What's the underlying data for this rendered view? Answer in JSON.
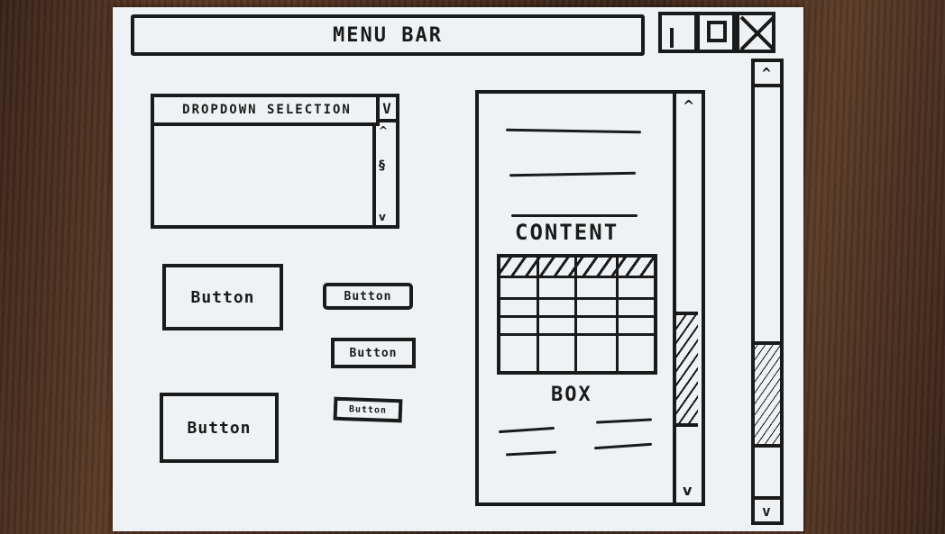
{
  "menu_bar": {
    "label": "MENU BAR"
  },
  "window_controls": {
    "minimize_icon": "minimize-icon",
    "maximize_icon": "maximize-icon",
    "close_icon": "close-icon"
  },
  "dropdown": {
    "label": "DROPDOWN SELECTION",
    "toggle": "V",
    "scroll_up": "^",
    "scroll_down": "v"
  },
  "buttons": {
    "large_1": "Button",
    "large_2": "Button",
    "small_1": "Button",
    "small_2": "Button",
    "small_3": "Button"
  },
  "content_box": {
    "label_top": "CONTENT",
    "label_bottom": "BOX",
    "scroll_up": "^",
    "scroll_down": "v"
  },
  "main_scrollbar": {
    "scroll_up": "^",
    "scroll_down": "v"
  },
  "colors": {
    "ink": "#1a1a1a",
    "paper": "#eff2f4",
    "table": "#3c2519"
  }
}
